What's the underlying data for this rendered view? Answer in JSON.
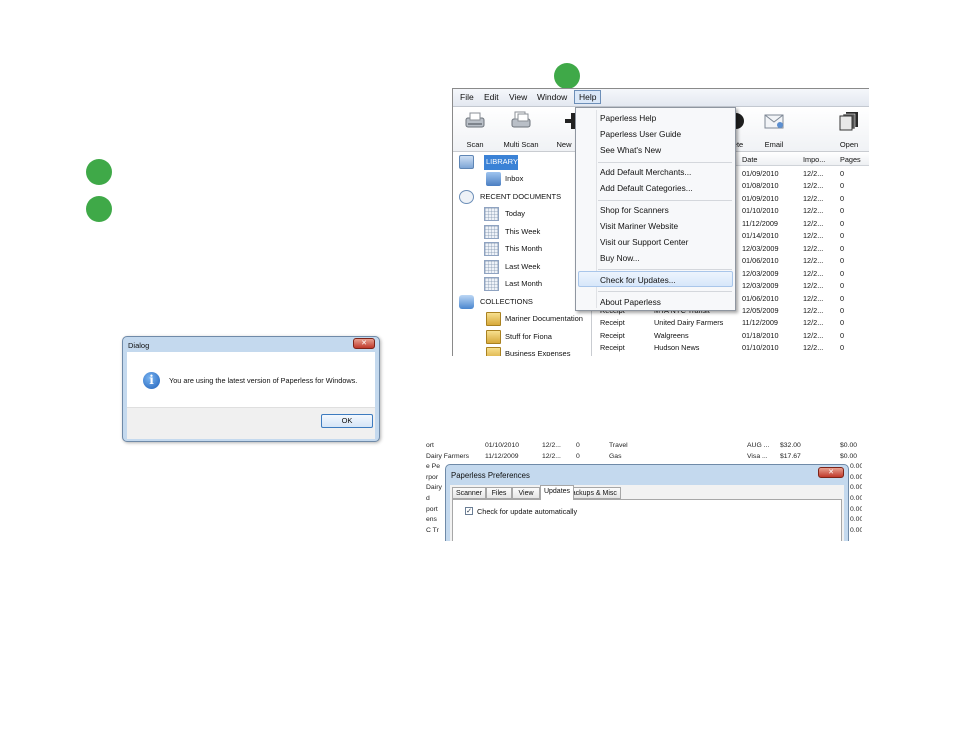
{
  "colors": {
    "step_marker": "#3fa948",
    "selection": "#3b82d6"
  },
  "app": {
    "menu": [
      "File",
      "Edit",
      "View",
      "Window",
      "Help"
    ],
    "toolbar": [
      {
        "label": "Scan",
        "icon": "scanner-icon"
      },
      {
        "label": "Multi Scan",
        "icon": "multi-scanner-icon"
      },
      {
        "label": "New",
        "icon": "plus-icon"
      },
      {
        "label": "ete",
        "icon": "delete-icon"
      },
      {
        "label": "Email",
        "icon": "email-icon"
      },
      {
        "label": "Open",
        "icon": "open-icon"
      }
    ],
    "sidebar": {
      "library": "LIBRARY",
      "inbox": "Inbox",
      "recent": "RECENT DOCUMENTS",
      "recent_items": [
        "Today",
        "This Week",
        "This Month",
        "Last Week",
        "Last Month"
      ],
      "collections": "COLLECTIONS",
      "collection_items": [
        "Mariner Documentation",
        "Stuff for Fiona",
        "Business Expenses"
      ]
    },
    "grid": {
      "headers": [
        "Date",
        "Impo...",
        "Pages"
      ],
      "rows": [
        [
          "01/09/2010",
          "12/2...",
          "0"
        ],
        [
          "01/08/2010",
          "12/2...",
          "0"
        ],
        [
          "01/09/2010",
          "12/2...",
          "0"
        ],
        [
          "01/10/2010",
          "12/2...",
          "0"
        ],
        [
          "11/12/2009",
          "12/2...",
          "0"
        ],
        [
          "01/14/2010",
          "12/2...",
          "0"
        ],
        [
          "12/03/2009",
          "12/2...",
          "0"
        ],
        [
          "01/06/2010",
          "12/2...",
          "0"
        ],
        [
          "12/03/2009",
          "12/2...",
          "0"
        ],
        [
          "12/03/2009",
          "12/2...",
          "0"
        ],
        [
          "01/06/2010",
          "12/2...",
          "0"
        ],
        [
          "12/05/2009",
          "12/2...",
          "0"
        ],
        [
          "11/12/2009",
          "12/2...",
          "0"
        ],
        [
          "01/18/2010",
          "12/2...",
          "0"
        ],
        [
          "01/10/2010",
          "12/2...",
          "0"
        ]
      ],
      "left_rows": [
        [
          "Receipt",
          "MTA NYC Transit"
        ],
        [
          "Receipt",
          "United Dairy Farmers"
        ],
        [
          "Receipt",
          "Walgreens"
        ],
        [
          "Receipt",
          "Hudson News"
        ]
      ]
    },
    "help_menu": {
      "group1": [
        "Paperless Help",
        "Paperless User Guide",
        "See What's New"
      ],
      "group2": [
        "Add Default Merchants...",
        "Add Default Categories..."
      ],
      "group3": [
        "Shop for Scanners",
        "Visit Mariner Website",
        "Visit our Support Center",
        "Buy Now..."
      ],
      "check_updates": "Check for Updates...",
      "about": "About Paperless"
    }
  },
  "dialog": {
    "title": "Dialog",
    "message": "You are using the latest version of Paperless for Windows.",
    "ok": "OK"
  },
  "prefs": {
    "bg_rows": [
      [
        "ort",
        "01/10/2010",
        "12/2...",
        "0",
        "Travel",
        "",
        "AUG ...",
        "$32.00",
        "$0.00"
      ],
      [
        "Dairy Farmers",
        "11/12/2009",
        "12/2...",
        "0",
        "Gas",
        "",
        "Visa ...",
        "$17.67",
        "$0.00"
      ],
      [
        "e Pe",
        "",
        "",
        "",
        "",
        "",
        "",
        "",
        "0.00"
      ],
      [
        "rpor",
        "",
        "",
        "",
        "",
        "",
        "",
        "",
        "0.00"
      ],
      [
        "Dairy",
        "",
        "",
        "",
        "",
        "",
        "",
        "",
        "0.00"
      ],
      [
        "d",
        "",
        "",
        "",
        "",
        "",
        "",
        "",
        "0.00"
      ],
      [
        "port",
        "",
        "",
        "",
        "",
        "",
        "",
        "",
        "0.00"
      ],
      [
        "ens",
        "",
        "",
        "",
        "",
        "",
        "",
        "",
        "0.00"
      ],
      [
        "C Tr",
        "",
        "",
        "",
        "",
        "",
        "",
        "",
        "0.00"
      ]
    ],
    "title": "Paperless Preferences",
    "tabs": [
      "Scanner",
      "Files",
      "View",
      "Updates",
      "Backups & Misc"
    ],
    "active_tab": "Updates",
    "checkbox_label": "Check for update automatically",
    "checkbox_checked": true
  }
}
